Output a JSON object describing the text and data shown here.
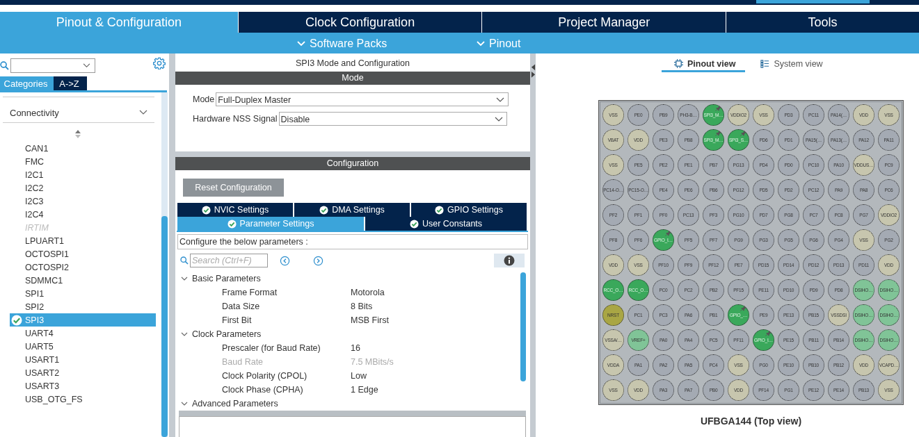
{
  "top_tabs": [
    {
      "label": "Pinout & Configuration",
      "selected": true
    },
    {
      "label": "Clock Configuration",
      "selected": false
    },
    {
      "label": "Project Manager",
      "selected": false
    },
    {
      "label": "Tools",
      "selected": false
    }
  ],
  "sub_menu": [
    "Software Packs",
    "Pinout"
  ],
  "left_panel": {
    "view_tabs": [
      {
        "label": "Categories",
        "selected": true
      },
      {
        "label": "A->Z",
        "selected": false
      }
    ],
    "category": "Connectivity",
    "items": [
      {
        "label": "CAN1",
        "disabled": false,
        "selected": false,
        "configured": false
      },
      {
        "label": "FMC",
        "disabled": false,
        "selected": false,
        "configured": false
      },
      {
        "label": "I2C1",
        "disabled": false,
        "selected": false,
        "configured": false
      },
      {
        "label": "I2C2",
        "disabled": false,
        "selected": false,
        "configured": false
      },
      {
        "label": "I2C3",
        "disabled": false,
        "selected": false,
        "configured": false
      },
      {
        "label": "I2C4",
        "disabled": false,
        "selected": false,
        "configured": false
      },
      {
        "label": "IRTIM",
        "disabled": true,
        "selected": false,
        "configured": false
      },
      {
        "label": "LPUART1",
        "disabled": false,
        "selected": false,
        "configured": false
      },
      {
        "label": "OCTOSPI1",
        "disabled": false,
        "selected": false,
        "configured": false
      },
      {
        "label": "OCTOSPI2",
        "disabled": false,
        "selected": false,
        "configured": false
      },
      {
        "label": "SDMMC1",
        "disabled": false,
        "selected": false,
        "configured": false
      },
      {
        "label": "SPI1",
        "disabled": false,
        "selected": false,
        "configured": false
      },
      {
        "label": "SPI2",
        "disabled": false,
        "selected": false,
        "configured": false
      },
      {
        "label": "SPI3",
        "disabled": false,
        "selected": true,
        "configured": true
      },
      {
        "label": "UART4",
        "disabled": false,
        "selected": false,
        "configured": false
      },
      {
        "label": "UART5",
        "disabled": false,
        "selected": false,
        "configured": false
      },
      {
        "label": "USART1",
        "disabled": false,
        "selected": false,
        "configured": false
      },
      {
        "label": "USART2",
        "disabled": false,
        "selected": false,
        "configured": false
      },
      {
        "label": "USART3",
        "disabled": false,
        "selected": false,
        "configured": false
      },
      {
        "label": "USB_OTG_FS",
        "disabled": false,
        "selected": false,
        "configured": false
      }
    ]
  },
  "config_panel": {
    "title": "SPI3 Mode and Configuration",
    "mode_header": "Mode",
    "fields": [
      {
        "label": "Mode",
        "value": "Full-Duplex Master"
      },
      {
        "label": "Hardware NSS Signal",
        "value": "Disable"
      }
    ],
    "config_header": "Configuration",
    "reset_button": "Reset Configuration",
    "tab_rows": [
      [
        {
          "label": "NVIC Settings",
          "selected": false
        },
        {
          "label": "DMA Settings",
          "selected": false
        },
        {
          "label": "GPIO Settings",
          "selected": false
        }
      ],
      [
        {
          "label": "Parameter Settings",
          "selected": true
        },
        {
          "label": "User Constants",
          "selected": false
        }
      ]
    ],
    "hint": "Configure the below parameters :",
    "search_placeholder": "Search (Ctrl+F)",
    "groups": [
      {
        "label": "Basic Parameters",
        "expanded": true,
        "params": [
          {
            "name": "Frame Format",
            "value": "Motorola",
            "disabled": false
          },
          {
            "name": "Data Size",
            "value": "8 Bits",
            "disabled": false
          },
          {
            "name": "First Bit",
            "value": "MSB First",
            "disabled": false
          }
        ]
      },
      {
        "label": "Clock Parameters",
        "expanded": true,
        "params": [
          {
            "name": "Prescaler (for Baud Rate)",
            "value": "16",
            "disabled": false
          },
          {
            "name": "Baud Rate",
            "value": "7.5 MBits/s",
            "disabled": true
          },
          {
            "name": "Clock Polarity (CPOL)",
            "value": "Low",
            "disabled": false
          },
          {
            "name": "Clock Phase (CPHA)",
            "value": "1 Edge",
            "disabled": false
          }
        ]
      },
      {
        "label": "Advanced Parameters",
        "expanded": true
      }
    ]
  },
  "pinout": {
    "view_tabs": [
      {
        "label": "Pinout view",
        "selected": true
      },
      {
        "label": "System view",
        "selected": false
      }
    ],
    "caption": "UFBGA144 (Top view)",
    "rows": [
      [
        {
          "label": "VSS",
          "kind": "power"
        },
        {
          "label": "PE0",
          "kind": "io"
        },
        {
          "label": "PB9",
          "kind": "io"
        },
        {
          "label": "PH3-B…",
          "kind": "io"
        },
        {
          "label": "SPI3_M…",
          "kind": "pinned"
        },
        {
          "label": "VDDIO2",
          "kind": "power"
        },
        {
          "label": "VSS",
          "kind": "power"
        },
        {
          "label": "PD3",
          "kind": "io"
        },
        {
          "label": "PC11",
          "kind": "io"
        },
        {
          "label": "PA14(…",
          "kind": "io"
        },
        {
          "label": "VDD",
          "kind": "power"
        },
        {
          "label": "VSS",
          "kind": "power"
        }
      ],
      [
        {
          "label": "VBAT",
          "kind": "power"
        },
        {
          "label": "VDD",
          "kind": "power"
        },
        {
          "label": "PE3",
          "kind": "io"
        },
        {
          "label": "PB8",
          "kind": "io"
        },
        {
          "label": "SPI3_M…",
          "kind": "pinned"
        },
        {
          "label": "SPI3_S…",
          "kind": "pinned"
        },
        {
          "label": "PD6",
          "kind": "io"
        },
        {
          "label": "PD1",
          "kind": "io"
        },
        {
          "label": "PA15(…",
          "kind": "io"
        },
        {
          "label": "PA13(…",
          "kind": "io"
        },
        {
          "label": "PA12",
          "kind": "io"
        },
        {
          "label": "PA11",
          "kind": "io"
        }
      ],
      [
        {
          "label": "VSS",
          "kind": "power"
        },
        {
          "label": "PE5",
          "kind": "io"
        },
        {
          "label": "PE2",
          "kind": "io"
        },
        {
          "label": "PE1",
          "kind": "io"
        },
        {
          "label": "PB7",
          "kind": "io"
        },
        {
          "label": "PG13",
          "kind": "io"
        },
        {
          "label": "PD4",
          "kind": "io"
        },
        {
          "label": "PD0",
          "kind": "io"
        },
        {
          "label": "PC10",
          "kind": "io"
        },
        {
          "label": "PA10",
          "kind": "io"
        },
        {
          "label": "VDDUS…",
          "kind": "power"
        },
        {
          "label": "PC9",
          "kind": "io"
        }
      ],
      [
        {
          "label": "PC14-O…",
          "kind": "io"
        },
        {
          "label": "PC15-O…",
          "kind": "io"
        },
        {
          "label": "PE4",
          "kind": "io"
        },
        {
          "label": "PE6",
          "kind": "io"
        },
        {
          "label": "PB6",
          "kind": "io"
        },
        {
          "label": "PG12",
          "kind": "io"
        },
        {
          "label": "PD5",
          "kind": "io"
        },
        {
          "label": "PD2",
          "kind": "io"
        },
        {
          "label": "PC12",
          "kind": "io"
        },
        {
          "label": "PA9",
          "kind": "io"
        },
        {
          "label": "PA8",
          "kind": "io"
        },
        {
          "label": "PC6",
          "kind": "io"
        }
      ],
      [
        {
          "label": "PF2",
          "kind": "io"
        },
        {
          "label": "PF1",
          "kind": "io"
        },
        {
          "label": "PF0",
          "kind": "io"
        },
        {
          "label": "PC13",
          "kind": "io"
        },
        {
          "label": "PF3",
          "kind": "io"
        },
        {
          "label": "PG10",
          "kind": "io"
        },
        {
          "label": "PD7",
          "kind": "io"
        },
        {
          "label": "PG8",
          "kind": "io"
        },
        {
          "label": "PC7",
          "kind": "io"
        },
        {
          "label": "PC8",
          "kind": "io"
        },
        {
          "label": "PG7",
          "kind": "io"
        },
        {
          "label": "VDDIO2",
          "kind": "power"
        }
      ],
      [
        {
          "label": "PF8",
          "kind": "io"
        },
        {
          "label": "PF6",
          "kind": "io"
        },
        {
          "label": "GPIO_I…",
          "kind": "pinned"
        },
        {
          "label": "PF5",
          "kind": "io"
        },
        {
          "label": "PF7",
          "kind": "io"
        },
        {
          "label": "PG9",
          "kind": "io"
        },
        {
          "label": "PG3",
          "kind": "io"
        },
        {
          "label": "PG5",
          "kind": "io"
        },
        {
          "label": "PG6",
          "kind": "io"
        },
        {
          "label": "PG4",
          "kind": "io"
        },
        {
          "label": "VSS",
          "kind": "power"
        },
        {
          "label": "PG2",
          "kind": "io"
        }
      ],
      [
        {
          "label": "VDD",
          "kind": "power"
        },
        {
          "label": "VSS",
          "kind": "power"
        },
        {
          "label": "PF10",
          "kind": "io"
        },
        {
          "label": "PF9",
          "kind": "io"
        },
        {
          "label": "PF12",
          "kind": "io"
        },
        {
          "label": "PE7",
          "kind": "io"
        },
        {
          "label": "PD15",
          "kind": "io"
        },
        {
          "label": "PD14",
          "kind": "io"
        },
        {
          "label": "PD12",
          "kind": "io"
        },
        {
          "label": "PD13",
          "kind": "io"
        },
        {
          "label": "PD11",
          "kind": "io"
        },
        {
          "label": "VDD",
          "kind": "power"
        }
      ],
      [
        {
          "label": "RCC_O…",
          "kind": "assigned"
        },
        {
          "label": "RCC_O…",
          "kind": "assigned"
        },
        {
          "label": "PC0",
          "kind": "io"
        },
        {
          "label": "PC2",
          "kind": "io"
        },
        {
          "label": "PB2",
          "kind": "io"
        },
        {
          "label": "PF15",
          "kind": "io"
        },
        {
          "label": "PE11",
          "kind": "io"
        },
        {
          "label": "PD10",
          "kind": "io"
        },
        {
          "label": "PD9",
          "kind": "io"
        },
        {
          "label": "PD8",
          "kind": "io"
        },
        {
          "label": "DSIHO…",
          "kind": "analog"
        },
        {
          "label": "DSIHO…",
          "kind": "analog"
        }
      ],
      [
        {
          "label": "NRST",
          "kind": "reset"
        },
        {
          "label": "PC1",
          "kind": "io"
        },
        {
          "label": "PC3",
          "kind": "io"
        },
        {
          "label": "PA6",
          "kind": "io"
        },
        {
          "label": "PB1",
          "kind": "io"
        },
        {
          "label": "GPIO_…",
          "kind": "pinned"
        },
        {
          "label": "PE9",
          "kind": "io"
        },
        {
          "label": "PE13",
          "kind": "io"
        },
        {
          "label": "PB15",
          "kind": "io"
        },
        {
          "label": "VSSDSI",
          "kind": "power"
        },
        {
          "label": "DSIHO…",
          "kind": "analog"
        },
        {
          "label": "DSIHO…",
          "kind": "analog"
        }
      ],
      [
        {
          "label": "VSSA/…",
          "kind": "power"
        },
        {
          "label": "VREF+",
          "kind": "analog"
        },
        {
          "label": "PA0",
          "kind": "io"
        },
        {
          "label": "PA4",
          "kind": "io"
        },
        {
          "label": "PC5",
          "kind": "io"
        },
        {
          "label": "PF11",
          "kind": "io"
        },
        {
          "label": "GPIO_I…",
          "kind": "pinned"
        },
        {
          "label": "PE15",
          "kind": "io"
        },
        {
          "label": "PB11",
          "kind": "io"
        },
        {
          "label": "PB14",
          "kind": "io"
        },
        {
          "label": "DSIHO…",
          "kind": "analog"
        },
        {
          "label": "DSIHO…",
          "kind": "analog"
        }
      ],
      [
        {
          "label": "VDDA",
          "kind": "power"
        },
        {
          "label": "PA1",
          "kind": "io"
        },
        {
          "label": "PA2",
          "kind": "io"
        },
        {
          "label": "PA5",
          "kind": "io"
        },
        {
          "label": "PC4",
          "kind": "io"
        },
        {
          "label": "VSS",
          "kind": "power"
        },
        {
          "label": "PG0",
          "kind": "io"
        },
        {
          "label": "PE10",
          "kind": "io"
        },
        {
          "label": "PB10",
          "kind": "io"
        },
        {
          "label": "PB12",
          "kind": "io"
        },
        {
          "label": "VDD",
          "kind": "power"
        },
        {
          "label": "VCAPD…",
          "kind": "power"
        }
      ],
      [
        {
          "label": "VSS",
          "kind": "power"
        },
        {
          "label": "VDD",
          "kind": "power"
        },
        {
          "label": "PA3",
          "kind": "io"
        },
        {
          "label": "PA7",
          "kind": "io"
        },
        {
          "label": "PB0",
          "kind": "io"
        },
        {
          "label": "VDD",
          "kind": "power"
        },
        {
          "label": "PF14",
          "kind": "io"
        },
        {
          "label": "PG1",
          "kind": "io"
        },
        {
          "label": "PE12",
          "kind": "io"
        },
        {
          "label": "PE14",
          "kind": "io"
        },
        {
          "label": "PB13",
          "kind": "io"
        },
        {
          "label": "VSS",
          "kind": "power"
        }
      ]
    ]
  }
}
